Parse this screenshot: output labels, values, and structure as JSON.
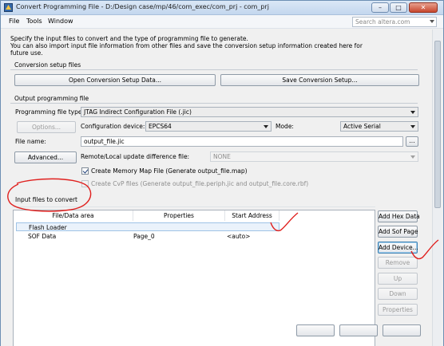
{
  "window": {
    "title": "Convert Programming File - D:/Design case/mp/46/com_exec/com_prj - com_prj",
    "minimize": "–",
    "maximize": "□",
    "close": "✕"
  },
  "menu": {
    "file": "File",
    "tools": "Tools",
    "window": "Window",
    "search_placeholder": "Search altera.com"
  },
  "description": "Specify the input files to convert and the type of programming file to generate.\nYou can also import input file information from other files and save the conversion setup information created here for future use.",
  "conversion_setup": {
    "title": "Conversion setup files",
    "open_button": "Open Conversion Setup Data...",
    "save_button": "Save Conversion Setup..."
  },
  "output": {
    "title": "Output programming file",
    "file_type_label": "Programming file type:",
    "file_type_value": "JTAG Indirect Configuration File (.jic)",
    "options_button": "Options...",
    "config_device_label": "Configuration device:",
    "config_device_value": "EPCS64",
    "mode_label": "Mode:",
    "mode_value": "Active Serial",
    "file_name_label": "File name:",
    "file_name_value": "output_file.jic",
    "browse_button": "...",
    "advanced_button": "Advanced...",
    "diff_file_label": "Remote/Local update difference file:",
    "diff_file_value": "NONE",
    "memory_map_label": "Create Memory Map File (Generate output_file.map)",
    "cvp_label": "Create CvP files (Generate output_file.periph.jic and output_file.core.rbf)"
  },
  "input": {
    "title": "Input files to convert",
    "columns": [
      "File/Data area",
      "Properties",
      "Start Address"
    ],
    "rows": [
      {
        "file": "Flash Loader",
        "properties": "",
        "address": ""
      },
      {
        "file": "SOF Data",
        "properties": "Page_0",
        "address": "<auto>"
      }
    ],
    "buttons": {
      "add_hex": "Add Hex Data",
      "add_sof": "Add Sof Page",
      "add_device": "Add Device...",
      "remove": "Remove",
      "up": "Up",
      "down": "Down",
      "properties": "Properties"
    }
  },
  "colors": {
    "annotation": "#e0201e",
    "titlebar": "#c3d7ee"
  }
}
